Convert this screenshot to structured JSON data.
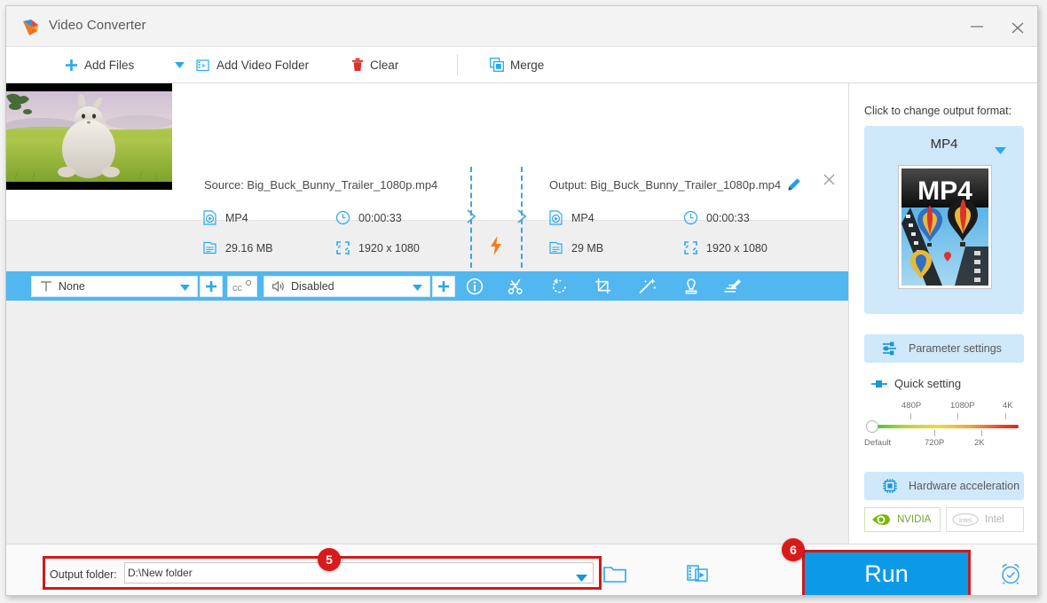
{
  "window": {
    "title": "Video Converter",
    "logo_icon": "app-logo-play-icon",
    "minimize_icon": "minimize-icon",
    "close_icon": "close-icon"
  },
  "toolbar": {
    "add_files": "Add Files",
    "add_files_icon": "plus-icon",
    "dropdown_icon": "chevron-down-icon",
    "add_video_folder": "Add Video Folder",
    "add_video_folder_icon": "video-folder-icon",
    "clear": "Clear",
    "clear_icon": "trash-icon",
    "merge": "Merge",
    "merge_icon": "merge-squares-icon"
  },
  "file_item": {
    "thumbnail_icon": "video-thumbnail",
    "source": {
      "label": "Source: Big_Buck_Bunny_Trailer_1080p.mp4",
      "format": "MP4",
      "format_icon": "media-file-icon",
      "duration": "00:00:33",
      "duration_icon": "clock-icon",
      "size": "29.16 MB",
      "size_icon": "document-icon",
      "resolution": "1920 x 1080",
      "resolution_icon": "resize-icon"
    },
    "output": {
      "label": "Output: Big_Buck_Bunny_Trailer_1080p.mp4",
      "format": "MP4",
      "format_icon": "media-file-icon",
      "duration": "00:00:33",
      "duration_icon": "clock-icon",
      "size": "29 MB",
      "size_icon": "document-icon",
      "resolution": "1920 x 1080",
      "resolution_icon": "resize-icon"
    },
    "convert_icon": "lightning-bolt-icon",
    "arrow_icon": "chevron-right-icon",
    "edit_icon": "pencil-icon",
    "remove_icon": "close-icon"
  },
  "action_bar": {
    "subtitle_value": "None",
    "subtitle_icon": "subtitle-T-icon",
    "subtitle_add_icon": "plus-icon",
    "cc_icon": "closed-caption-icon",
    "audio_value": "Disabled",
    "audio_icon": "speaker-icon",
    "audio_add_icon": "plus-icon",
    "dropdown_icon": "chevron-down-icon",
    "tools": [
      {
        "name": "info-icon"
      },
      {
        "name": "trim-scissors-icon"
      },
      {
        "name": "rotate-icon"
      },
      {
        "name": "crop-icon"
      },
      {
        "name": "effect-wand-icon"
      },
      {
        "name": "watermark-icon"
      },
      {
        "name": "subtitle-edit-icon"
      }
    ]
  },
  "sidebar": {
    "hint": "Click to change output format:",
    "format_name": "MP4",
    "format_caret_icon": "chevron-down-icon",
    "format_thumb_label": "MP4",
    "format_thumb_icon": "mp4-format-thumbnail",
    "parameter_settings": "Parameter settings",
    "parameter_settings_icon": "sliders-icon",
    "quick_setting": "Quick setting",
    "quick_setting_icon": "quick-toggle-icon",
    "slider": {
      "labels_top": [
        "480P",
        "1080P",
        "4K"
      ],
      "labels_bottom": [
        "Default",
        "720P",
        "2K"
      ],
      "knob_position": "Default"
    },
    "hardware_acceleration": "Hardware acceleration",
    "hardware_acceleration_icon": "cpu-chip-icon",
    "nvidia": "NVIDIA",
    "nvidia_icon": "nvidia-eye-icon",
    "intel": "Intel",
    "intel_icon": "intel-logo-icon"
  },
  "bottom": {
    "output_folder_label": "Output folder:",
    "output_folder_value": "D:\\New folder",
    "output_folder_caret_icon": "chevron-down-icon",
    "browse_icon": "open-folder-icon",
    "media_folder_icon": "media-folder-icon",
    "run_label": "Run",
    "alarm_icon": "alarm-clock-icon"
  },
  "annotations": {
    "badge_5": "5",
    "badge_6": "6"
  },
  "colors": {
    "accent_blue": "#29a9ea",
    "bar_blue": "#52b6f0",
    "run_blue": "#0b9ae8",
    "highlight_red": "#cf1a1a",
    "badge_red": "#d81a1a",
    "bolt_orange": "#f47b20",
    "nvidia_green": "#76b900"
  }
}
